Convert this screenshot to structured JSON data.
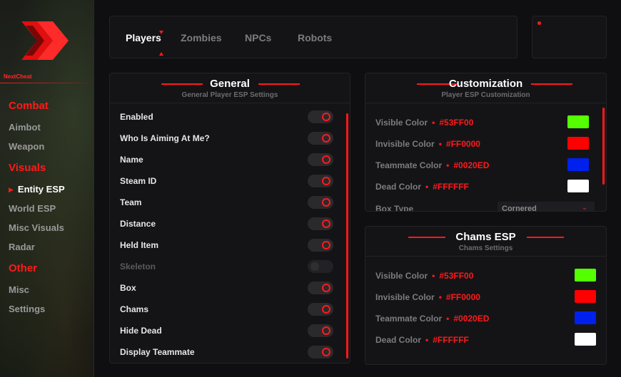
{
  "brand": {
    "name": "NextCheat"
  },
  "sidebar": {
    "sections": [
      {
        "title": "Combat",
        "items": [
          "Aimbot",
          "Weapon"
        ]
      },
      {
        "title": "Visuals",
        "items": [
          "Entity ESP",
          "World ESP",
          "Misc Visuals",
          "Radar"
        ]
      },
      {
        "title": "Other",
        "items": [
          "Misc",
          "Settings"
        ]
      }
    ],
    "active_item": "Entity ESP"
  },
  "tabs": {
    "items": [
      "Players",
      "Zombies",
      "NPCs",
      "Robots"
    ],
    "active": "Players"
  },
  "general": {
    "title": "General",
    "subtitle": "General Player ESP Settings",
    "rows": [
      {
        "label": "Enabled",
        "on": true
      },
      {
        "label": "Who Is Aiming At Me?",
        "on": true
      },
      {
        "label": "Name",
        "on": true
      },
      {
        "label": "Steam ID",
        "on": true
      },
      {
        "label": "Team",
        "on": true
      },
      {
        "label": "Distance",
        "on": true
      },
      {
        "label": "Held Item",
        "on": true
      },
      {
        "label": "Skeleton",
        "on": false
      },
      {
        "label": "Box",
        "on": true
      },
      {
        "label": "Chams",
        "on": true
      },
      {
        "label": "Hide Dead",
        "on": true
      },
      {
        "label": "Display Teammate",
        "on": true
      }
    ]
  },
  "customization": {
    "title": "Customization",
    "subtitle": "Player ESP Customization",
    "colors": [
      {
        "label": "Visible Color",
        "hex": "#53FF00",
        "swatch": "#53FF00"
      },
      {
        "label": "Invisible Color",
        "hex": "#FF0000",
        "swatch": "#FF0000"
      },
      {
        "label": "Teammate Color",
        "hex": "#0020ED",
        "swatch": "#0020ED"
      },
      {
        "label": "Dead Color",
        "hex": "#FFFFFF",
        "swatch": "#FFFFFF"
      }
    ],
    "box_type": {
      "label": "Box Type",
      "value": "Cornered"
    }
  },
  "chams": {
    "title": "Chams ESP",
    "subtitle": "Chams Settings",
    "colors": [
      {
        "label": "Visible Color",
        "hex": "#53FF00",
        "swatch": "#53FF00"
      },
      {
        "label": "Invisible Color",
        "hex": "#FF0000",
        "swatch": "#FF0000"
      },
      {
        "label": "Teammate Color",
        "hex": "#0020ED",
        "swatch": "#0020ED"
      },
      {
        "label": "Dead Color",
        "hex": "#FFFFFF",
        "swatch": "#FFFFFF"
      }
    ]
  },
  "theme": {
    "accent": "#FF1A1A",
    "bg": "#0F0F12",
    "panel": "#141417"
  }
}
